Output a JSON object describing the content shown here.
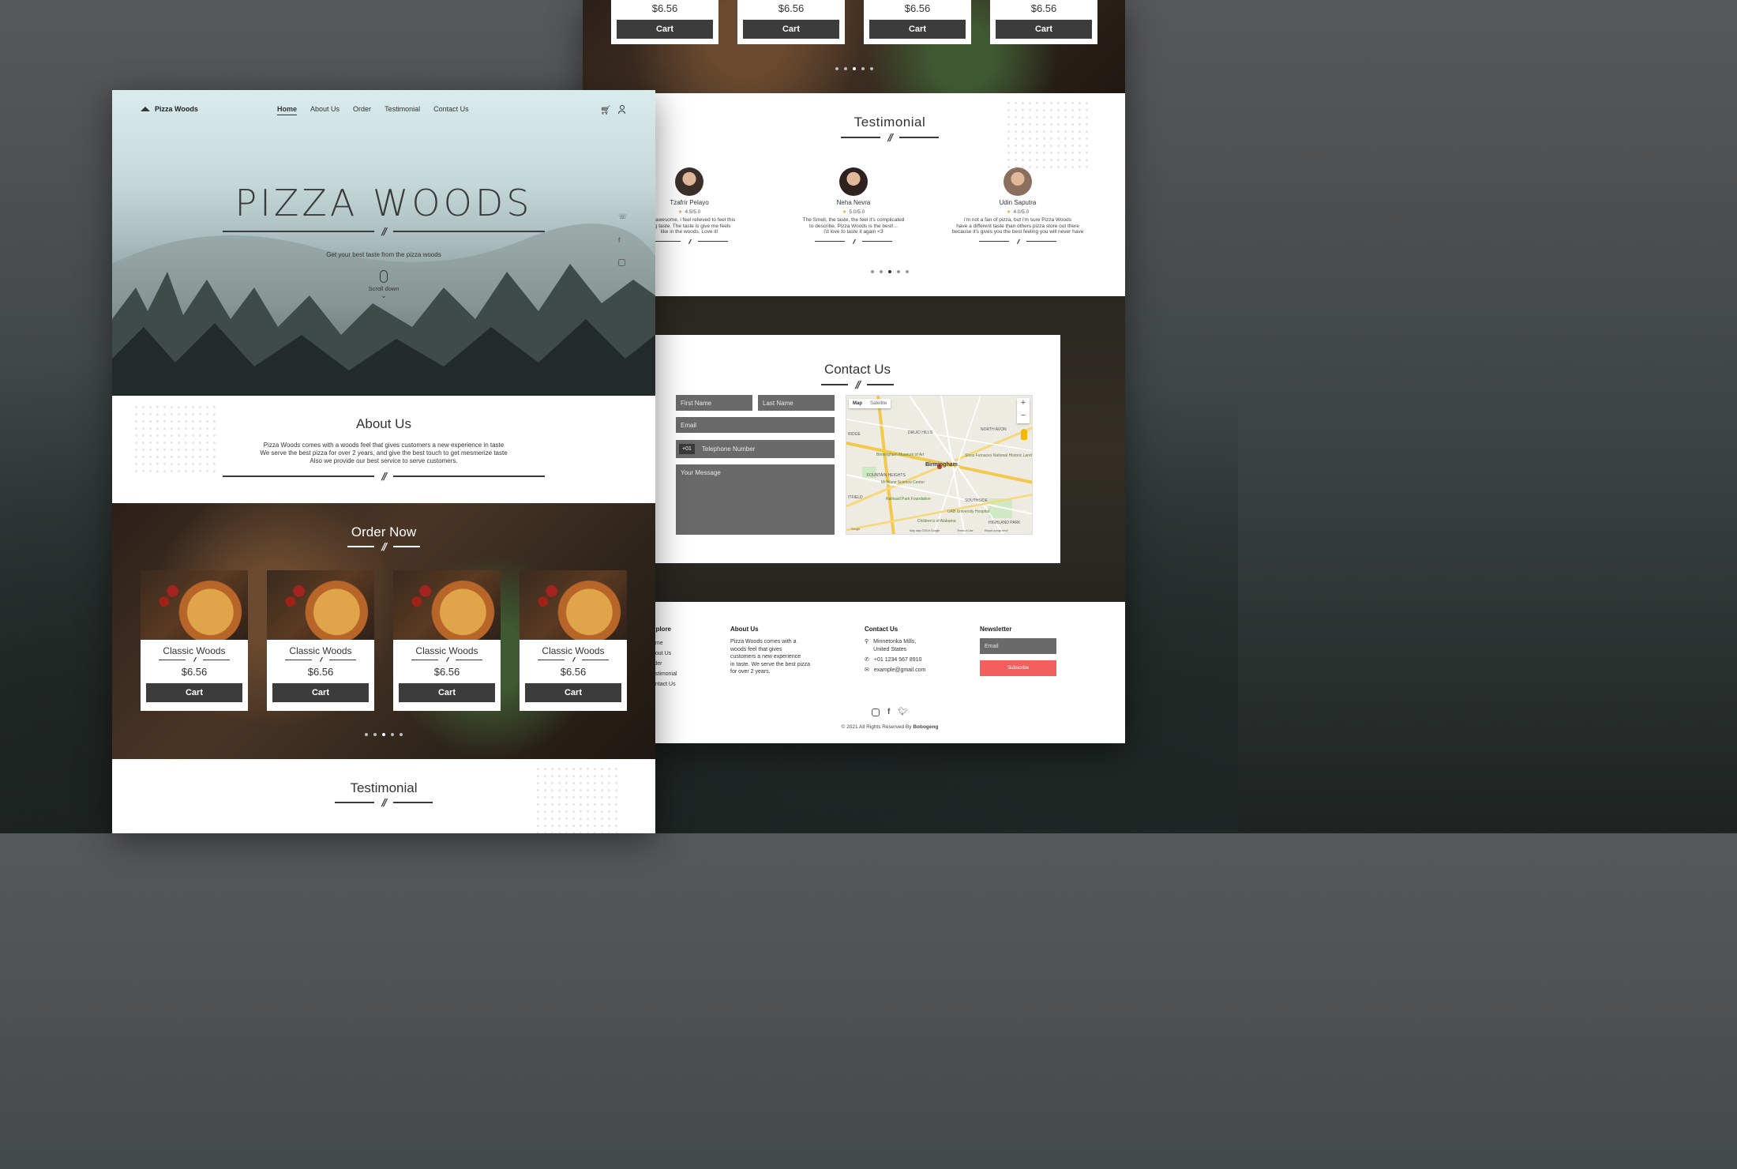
{
  "left": {
    "brand": "Pizza Woods",
    "nav": [
      "Home",
      "About Us",
      "Order",
      "Testimonial",
      "Contact Us"
    ],
    "hero": {
      "title": "PIZZA WOODS",
      "tagline": "Get your best taste from the pizza woods",
      "scroll": "Scroll down"
    },
    "about": {
      "title": "About Us",
      "lines": [
        "Pizza Woods comes with a woods feel that gives customers a new experience in taste",
        "We serve the best pizza for over 2 years, and give the best touch to get mesmerize taste",
        "Also we provide our best service to serve customers."
      ]
    },
    "order": {
      "title": "Order Now",
      "items": [
        {
          "name": "Classic Woods",
          "price": "$6.56",
          "btn": "Cart"
        },
        {
          "name": "Classic Woods",
          "price": "$6.56",
          "btn": "Cart"
        },
        {
          "name": "Classic Woods",
          "price": "$6.56",
          "btn": "Cart"
        },
        {
          "name": "Classic Woods",
          "price": "$6.56",
          "btn": "Cart"
        }
      ]
    },
    "testimonial_title": "Testimonial"
  },
  "right": {
    "top_cards": [
      {
        "price": "$6.56",
        "btn": "Cart"
      },
      {
        "price": "$6.56",
        "btn": "Cart"
      },
      {
        "price": "$6.56",
        "btn": "Cart"
      },
      {
        "price": "$6.56",
        "btn": "Cart"
      }
    ],
    "testimonial": {
      "title": "Testimonial",
      "people": [
        {
          "name": "Tzafrir Pelayo",
          "rating": "4.5/5.0",
          "text": [
            "ds is awesome, i feel relieved to feel this",
            "zing taste. The taste is give me feels",
            "like in the woods. Love it!"
          ]
        },
        {
          "name": "Neha Nevra",
          "rating": "5.0/5.0",
          "text": [
            "The Smell, the taste, the feel it's complicated",
            "to describe, Pizza Woods is the best!...",
            "i'd love to taste it again <3"
          ]
        },
        {
          "name": "Udin Saputra",
          "rating": "4.0/5.0",
          "text": [
            "i'm not a fan of pizza, but i'm sure Pizza Woods",
            "have a different taste than others pizza store out there",
            "because it's gives you the best feeling you will never have"
          ]
        }
      ]
    },
    "contact": {
      "title": "Contact Us",
      "first": "First Name",
      "last": "Last Name",
      "email": "Email",
      "code": "+01",
      "phone": "Telephone Number",
      "message": "Your Message",
      "map": {
        "tab1": "Map",
        "tab2": "Satellite",
        "city": "Birmingham",
        "labels": [
          "DRUID HILLS",
          "NORTH AVON",
          "FOUNTAIN HEIGHTS",
          "SOUTHSIDE",
          "HIGHLAND PARK",
          "Birmingham Museum of Art",
          "McWane Science Center",
          "Railroad Park Foundation",
          "UAB University Hospital",
          "Children's of Alabama",
          "Sloss Furnaces National Historic Landmark",
          "RIDGE",
          "ITFIELD",
          "Map data ©2019 Google",
          "Terms of Use",
          "Report a map error",
          "Google"
        ]
      }
    },
    "footer": {
      "explore": {
        "title": "Explore",
        "items": [
          "Home",
          "About Us",
          "Order",
          "Testimonial",
          "Contact Us"
        ],
        "shown": [
          "ome",
          "bout Us",
          "rder",
          "estimonial",
          "ontact Us"
        ],
        "title_shown": "xplore"
      },
      "about": {
        "title": "About Us",
        "lines": [
          "Pizza Woods comes with a",
          "woods feel that gives",
          "customers a new experience",
          "in taste. We serve the best pizza",
          "for over 2 years."
        ]
      },
      "contact": {
        "title": "Contact Us",
        "address": [
          "Minnetonka Mills,",
          "United States"
        ],
        "phone": "+01 1234 567 8910",
        "email": "example@gmail.com"
      },
      "newsletter": {
        "title": "Newsletter",
        "placeholder": "Email",
        "btn": "Subscribe"
      },
      "copyright": "© 2021 All Rights Reserved By ",
      "author": "Bobogeng"
    }
  }
}
